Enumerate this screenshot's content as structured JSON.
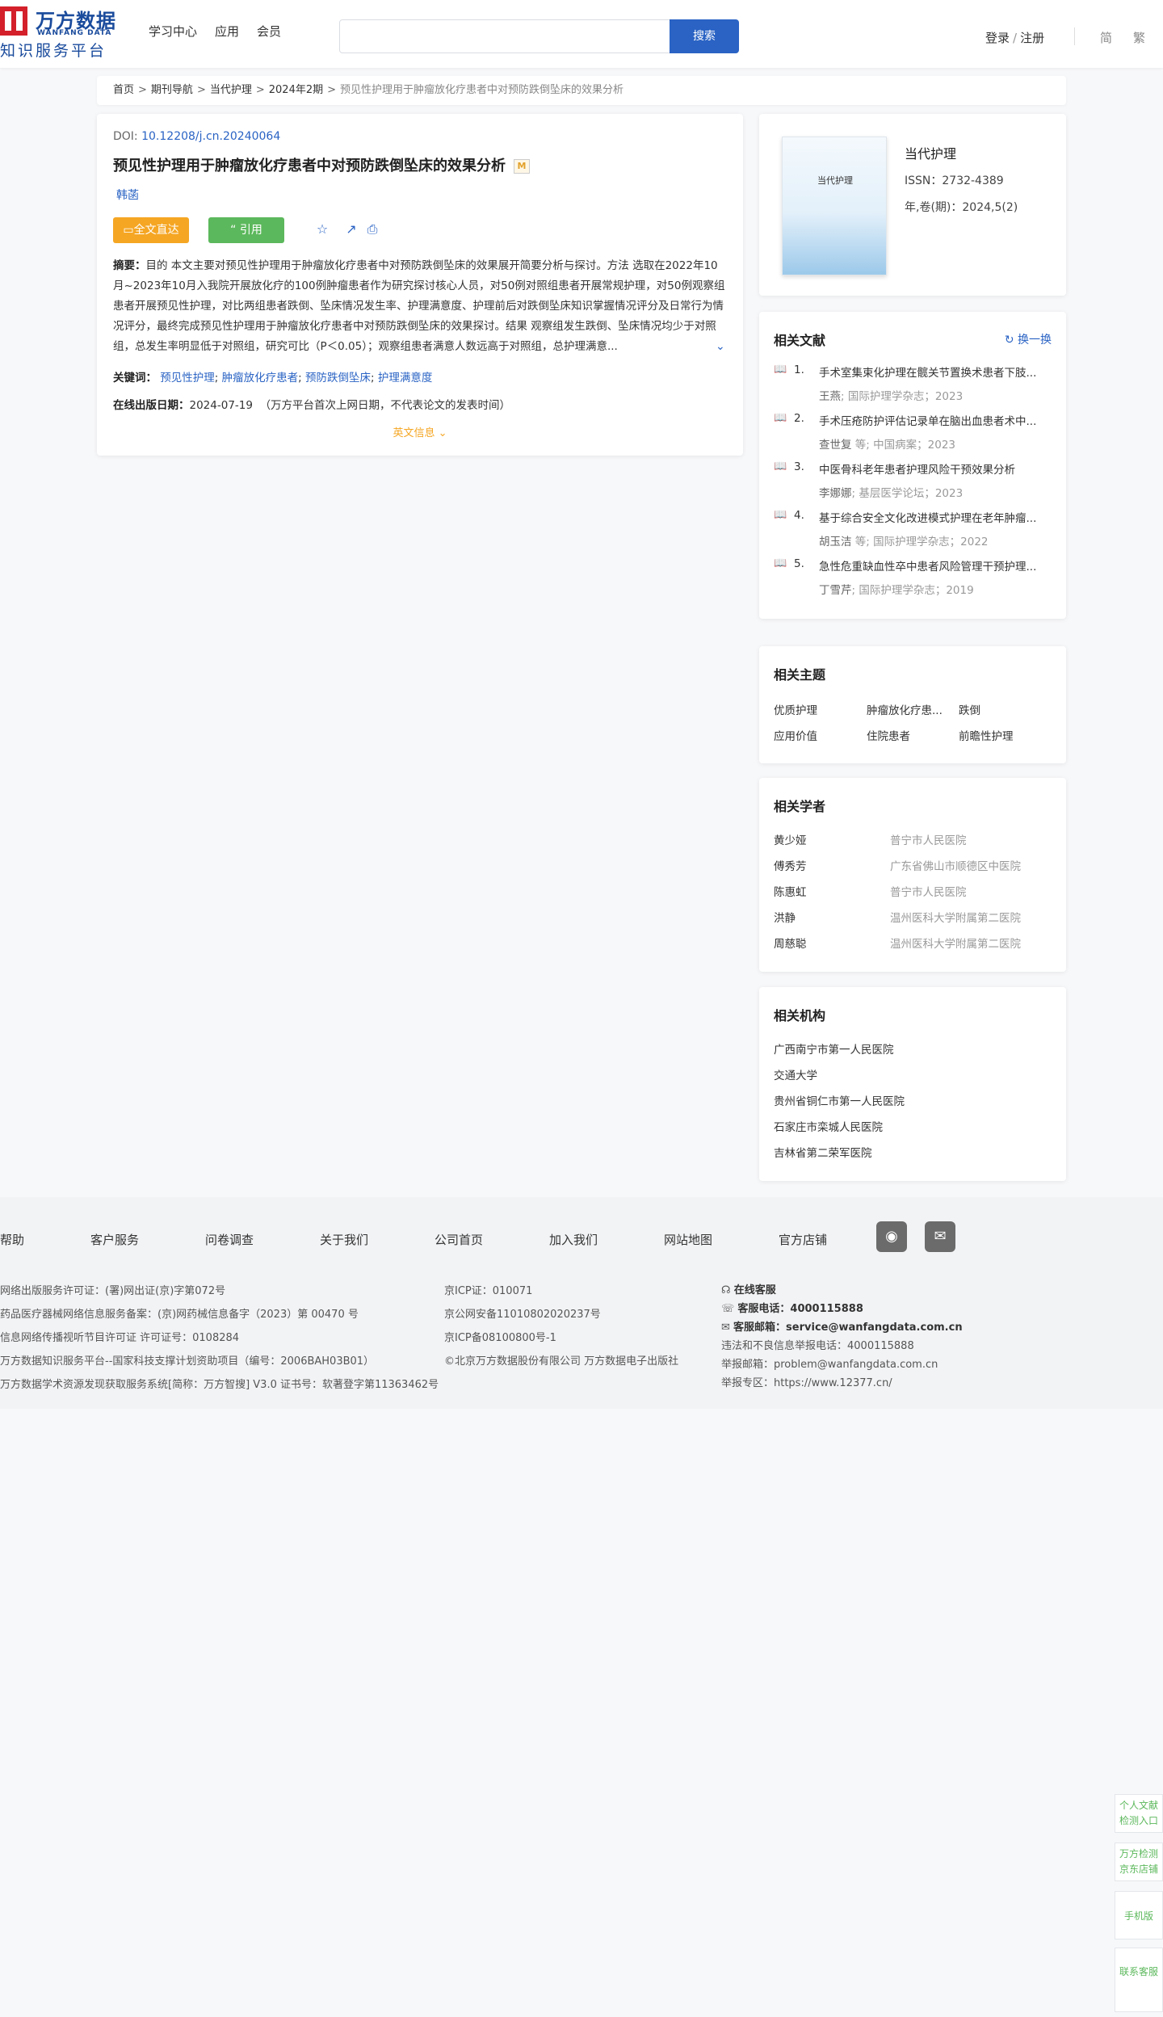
{
  "header": {
    "logo_cn": "万方数据",
    "logo_en": "WANFANG DATA",
    "logo_sub": "知识服务平台",
    "nav": [
      "学习中心",
      "应用",
      "会员"
    ],
    "search_placeholder": "",
    "search_btn": "搜索",
    "login": "登录",
    "register": "注册",
    "lang_simplified": "简",
    "lang_traditional": "繁"
  },
  "breadcrumb": [
    "首页",
    "期刊导航",
    "当代护理",
    "2024年2期",
    "预见性护理用于肿瘤放化疗患者中对预防跌倒坠床的效果分析"
  ],
  "article": {
    "doi_label": "DOI:",
    "doi": "10.12208/j.cn.20240064",
    "title": "预见性护理用于肿瘤放化疗患者中对预防跌倒坠床的效果分析",
    "m_badge": "M",
    "author": "韩菡",
    "btn_full": "全文直达",
    "btn_cite": "引用",
    "abstract_label": "摘要：",
    "abstract": "目的 本文主要对预见性护理用于肿瘤放化疗患者中对预防跌倒坠床的效果展开简要分析与探讨。方法 选取在2022年10月~2023年10月入我院开展放化疗的100例肿瘤患者作为研究探讨核心人员，对50例对照组患者开展常规护理，对50例观察组患者开展预见性护理，对比两组患者跌倒、坠床情况发生率、护理满意度、护理前后对跌倒坠床知识掌握情况评分及日常行为情况评分，最终完成预见性护理用于肿瘤放化疗患者中对预防跌倒坠床的效果探讨。结果 观察组发生跌倒、坠床情况均少于对照组，总发生率明显低于对照组，研究可比（P＜0.05）；观察组患者满意人数远高于对照组，总护理满意...",
    "keywords_label": "关键词：",
    "keywords": [
      "预见性护理",
      "肿瘤放化疗患者",
      "预防跌倒坠床",
      "护理满意度"
    ],
    "pub_label": "在线出版日期：",
    "pub_date": "2024-07-19",
    "pub_note": "（万方平台首次上网日期，不代表论文的发表时间）",
    "en_info": "英文信息"
  },
  "journal": {
    "cover_title": "当代护理",
    "name": "当代护理",
    "issn": "ISSN：2732-4389",
    "vol": "年,卷(期)：2024,5(2)"
  },
  "related": {
    "title": "相关文献",
    "refresh": "换一换",
    "items": [
      {
        "num": "1.",
        "title": "手术室集束化护理在髋关节置换术患者下肢...",
        "author": "王燕",
        "source": "国际护理学杂志；2023"
      },
      {
        "num": "2.",
        "title": "手术压疮防护评估记录单在脑出血患者术中...",
        "author": "查世复",
        "source": "中国病案；2023"
      },
      {
        "num": "3.",
        "title": "中医骨科老年患者护理风险干预效果分析",
        "author": "李娜娜",
        "source": "基层医学论坛；2023"
      },
      {
        "num": "4.",
        "title": "基于综合安全文化改进模式护理在老年肿瘤...",
        "author": "胡玉洁",
        "source": "国际护理学杂志；2022"
      },
      {
        "num": "5.",
        "title": "急性危重缺血性卒中患者风险管理干预护理...",
        "author": "丁雪芹",
        "source": "国际护理学杂志；2019"
      }
    ],
    "etal": "等"
  },
  "topics": {
    "title": "相关主题",
    "items": [
      "优质护理",
      "肿瘤放化疗患...",
      "跌倒",
      "应用价值",
      "住院患者",
      "前瞻性护理"
    ]
  },
  "scholars": {
    "title": "相关学者",
    "items": [
      {
        "name": "黄少娅",
        "org": "普宁市人民医院"
      },
      {
        "name": "傅秀芳",
        "org": "广东省佛山市顺德区中医院"
      },
      {
        "name": "陈惠虹",
        "org": "普宁市人民医院"
      },
      {
        "name": "洪静",
        "org": "温州医科大学附属第二医院"
      },
      {
        "name": "周慈聪",
        "org": "温州医科大学附属第二医院"
      }
    ]
  },
  "institutions": {
    "title": "相关机构",
    "items": [
      "广西南宁市第一人民医院",
      "交通大学",
      "贵州省铜仁市第一人民医院",
      "石家庄市栾城人民医院",
      "吉林省第二荣军医院"
    ]
  },
  "footer": {
    "nav": [
      "帮助",
      "客户服务",
      "问卷调查",
      "关于我们",
      "公司首页",
      "加入我们",
      "网站地图",
      "官方店铺"
    ],
    "left": [
      "网络出版服务许可证：(署)网出证(京)字第072号",
      "药品医疗器械网络信息服务备案：(京)网药械信息备字（2023）第 00470 号",
      "信息网络传播视听节目许可证 许可证号：0108284",
      "万方数据知识服务平台--国家科技支撑计划资助项目（编号：2006BAH03B01）",
      "万方数据学术资源发现获取服务系统[简称：万方智搜] V3.0 证书号：软著登字第11363462号"
    ],
    "mid": [
      "京ICP证：010071",
      "京公网安备11010802020237号",
      "京ICP备08100800号-1",
      "©北京万方数据股份有限公司 万方数据电子出版社"
    ],
    "online": "在线客服",
    "phone_label": "客服电话：",
    "phone": "4000115888",
    "email_label": "客服邮箱：",
    "email": "service@wanfangdata.com.cn",
    "report_phone": "违法和不良信息举报电话：4000115888",
    "report_email": "举报邮箱：problem@wanfangdata.com.cn",
    "report_zone": "举报专区：https://www.12377.cn/"
  },
  "side": [
    "个人文献检测入口",
    "万方检测京东店铺",
    "手机版",
    "联系客服"
  ]
}
